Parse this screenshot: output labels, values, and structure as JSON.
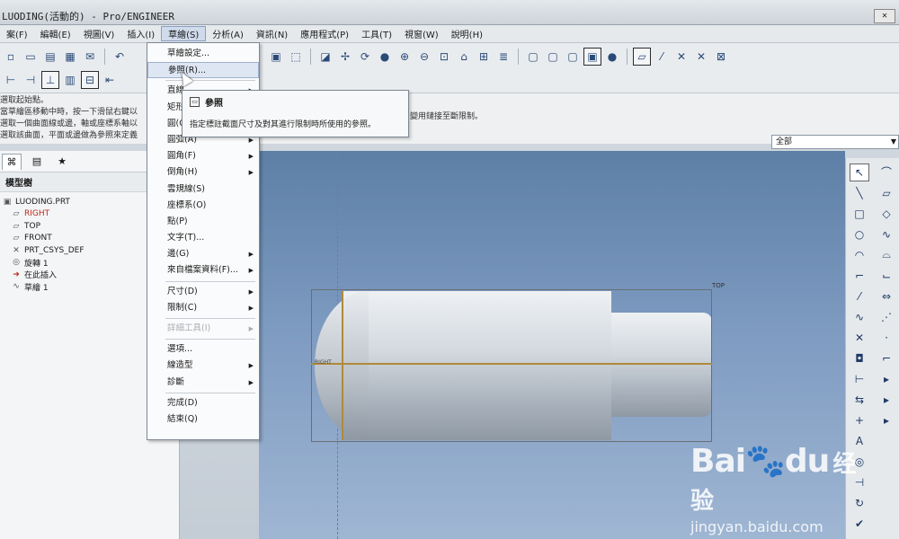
{
  "window": {
    "title": "LUODING(活動的) - Pro/ENGINEER",
    "close_icon": "close-icon"
  },
  "menubar": {
    "items": [
      "案(F)",
      "編輯(E)",
      "視圖(V)",
      "插入(I)",
      "草繪(S)",
      "分析(A)",
      "資訊(N)",
      "應用程式(P)",
      "工具(T)",
      "視窗(W)",
      "說明(H)"
    ],
    "active_index": 4
  },
  "message_area": {
    "lines": [
      "選取起始點。",
      "當草繪區移動中時，按一下滑鼠右鍵以",
      "選取一個曲面線或邊，軸或座標系軸以",
      "選取該曲面，平面或邊做為參照來定義"
    ],
    "tail": "變用鏈接至斷限制。"
  },
  "filter": {
    "value": "全部"
  },
  "model_tree": {
    "header": "模型樹",
    "nodes": [
      {
        "label": "LUODING.PRT",
        "icon": "part-icon"
      },
      {
        "label": "RIGHT",
        "icon": "datum-plane-icon",
        "highlight": true
      },
      {
        "label": "TOP",
        "icon": "datum-plane-icon"
      },
      {
        "label": "FRONT",
        "icon": "datum-plane-icon"
      },
      {
        "label": "PRT_CSYS_DEF",
        "icon": "csys-icon"
      },
      {
        "label": "旋轉 1",
        "icon": "revolve-icon"
      },
      {
        "label": "在此插入",
        "icon": "insert-here-icon"
      },
      {
        "label": "草繪 1",
        "icon": "sketch-icon"
      }
    ]
  },
  "sketch_menu": {
    "items": [
      {
        "label": "草繪設定...",
        "arrow": false
      },
      {
        "label": "參照(R)...",
        "arrow": false,
        "hover": true
      },
      {
        "sep": true
      },
      {
        "label": "直線",
        "arrow": true
      },
      {
        "label": "矩形",
        "arrow": true
      },
      {
        "label": "圓(C)",
        "arrow": true
      },
      {
        "label": "圓弧(A)",
        "arrow": true
      },
      {
        "label": "圓角(F)",
        "arrow": true
      },
      {
        "label": "倒角(H)",
        "arrow": true
      },
      {
        "label": "雲規線(S)",
        "arrow": false
      },
      {
        "label": "座標系(O)",
        "arrow": false
      },
      {
        "label": "點(P)",
        "arrow": false
      },
      {
        "label": "文字(T)...",
        "arrow": false
      },
      {
        "label": "邊(G)",
        "arrow": true
      },
      {
        "label": "來自檔案資料(F)...",
        "arrow": true
      },
      {
        "sep": true
      },
      {
        "label": "尺寸(D)",
        "arrow": true
      },
      {
        "label": "限制(C)",
        "arrow": true
      },
      {
        "sep": true
      },
      {
        "label": "詳細工具(I)",
        "arrow": true,
        "disabled": true
      },
      {
        "sep": true
      },
      {
        "label": "選項...",
        "arrow": false
      },
      {
        "label": "線造型",
        "arrow": true
      },
      {
        "label": "診斷",
        "arrow": true
      },
      {
        "sep": true
      },
      {
        "label": "完成(D)",
        "arrow": false
      },
      {
        "label": "結束(Q)",
        "arrow": false
      }
    ]
  },
  "tooltip": {
    "title": "參照",
    "description": "指定標註截面尺寸及對其進行限制時所使用的參照。"
  },
  "viewport": {
    "top_label": "TOP",
    "right_label": "RIGHT"
  },
  "watermark": {
    "logo": "Bai",
    "logo_end": "du",
    "cn": "经验",
    "url": "jingyan.baidu.com"
  }
}
